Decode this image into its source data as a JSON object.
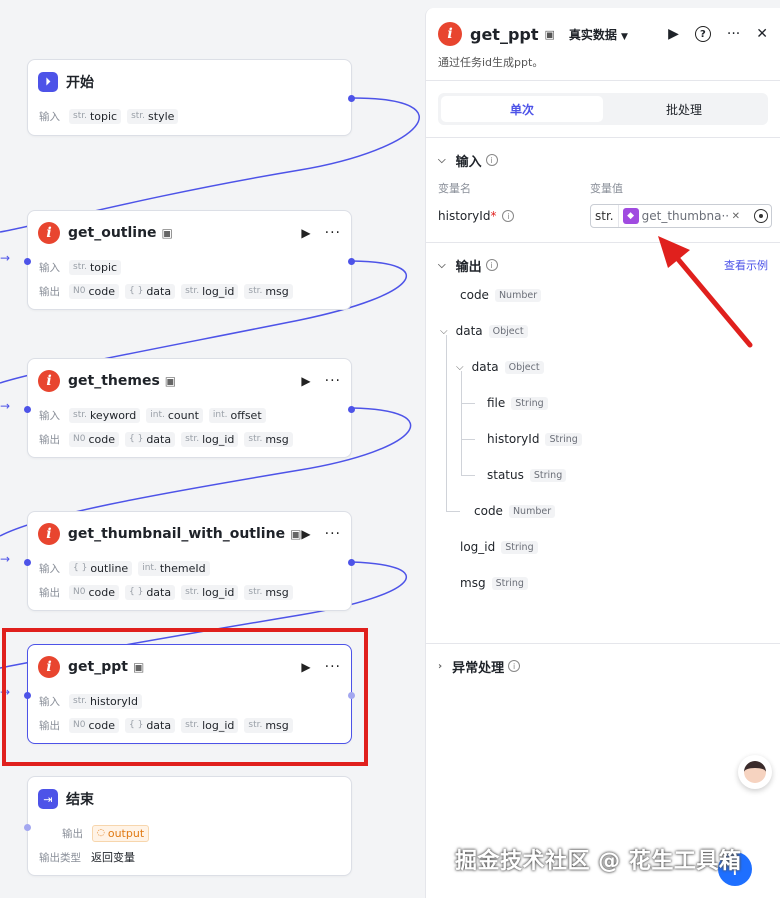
{
  "nodes": {
    "start": {
      "title": "开始",
      "input_label": "输入",
      "inputs": [
        {
          "type": "str.",
          "name": "topic"
        },
        {
          "type": "str.",
          "name": "style"
        }
      ]
    },
    "outline": {
      "title": "get_outline",
      "input_label": "输入",
      "output_label": "输出",
      "inputs": [
        {
          "type": "str.",
          "name": "topic"
        }
      ],
      "outputs": [
        {
          "type": "N0",
          "name": "code"
        },
        {
          "type": "{ }",
          "name": "data"
        },
        {
          "type": "str.",
          "name": "log_id"
        },
        {
          "type": "str.",
          "name": "msg"
        }
      ]
    },
    "themes": {
      "title": "get_themes",
      "input_label": "输入",
      "output_label": "输出",
      "inputs": [
        {
          "type": "str.",
          "name": "keyword"
        },
        {
          "type": "int.",
          "name": "count"
        },
        {
          "type": "int.",
          "name": "offset"
        }
      ],
      "outputs": [
        {
          "type": "N0",
          "name": "code"
        },
        {
          "type": "{ }",
          "name": "data"
        },
        {
          "type": "str.",
          "name": "log_id"
        },
        {
          "type": "str.",
          "name": "msg"
        }
      ]
    },
    "thumbnail": {
      "title": "get_thumbnail_with_outline",
      "input_label": "输入",
      "output_label": "输出",
      "inputs": [
        {
          "type": "{ }",
          "name": "outline"
        },
        {
          "type": "int.",
          "name": "themeId"
        }
      ],
      "outputs": [
        {
          "type": "N0",
          "name": "code"
        },
        {
          "type": "{ }",
          "name": "data"
        },
        {
          "type": "str.",
          "name": "log_id"
        },
        {
          "type": "str.",
          "name": "msg"
        }
      ]
    },
    "ppt": {
      "title": "get_ppt",
      "input_label": "输入",
      "output_label": "输出",
      "inputs": [
        {
          "type": "str.",
          "name": "historyId"
        }
      ],
      "outputs": [
        {
          "type": "N0",
          "name": "code"
        },
        {
          "type": "{ }",
          "name": "data"
        },
        {
          "type": "str.",
          "name": "log_id"
        },
        {
          "type": "str.",
          "name": "msg"
        }
      ]
    },
    "end": {
      "title": "结束",
      "output_label": "输出",
      "output_var": "output",
      "output_type_label": "输出类型",
      "output_type_value": "返回变量"
    }
  },
  "panel": {
    "title": "get_ppt",
    "mode": "真实数据",
    "description": "通过任务id生成ppt。",
    "tabs": [
      "单次",
      "批处理"
    ],
    "input_section": "输入",
    "col_name": "变量名",
    "col_value": "变量值",
    "input_var": "historyId",
    "ref_type": "str.",
    "ref_value": "get_thumbna···",
    "output_section": "输出",
    "example_link": "查看示例",
    "outputs": [
      {
        "name": "code",
        "type": "Number"
      },
      {
        "name": "data",
        "type": "Object"
      },
      {
        "name": "data",
        "type": "Object"
      },
      {
        "name": "file",
        "type": "String"
      },
      {
        "name": "historyId",
        "type": "String"
      },
      {
        "name": "status",
        "type": "String"
      },
      {
        "name": "code",
        "type": "Number"
      },
      {
        "name": "log_id",
        "type": "String"
      },
      {
        "name": "msg",
        "type": "String"
      }
    ],
    "error_section": "异常处理"
  },
  "watermark": "掘金技术社区 @ 花生工具箱",
  "colors": {
    "accent": "#4d53e8",
    "highlight": "#e0201d",
    "plugin_icon": "#e8452f"
  }
}
